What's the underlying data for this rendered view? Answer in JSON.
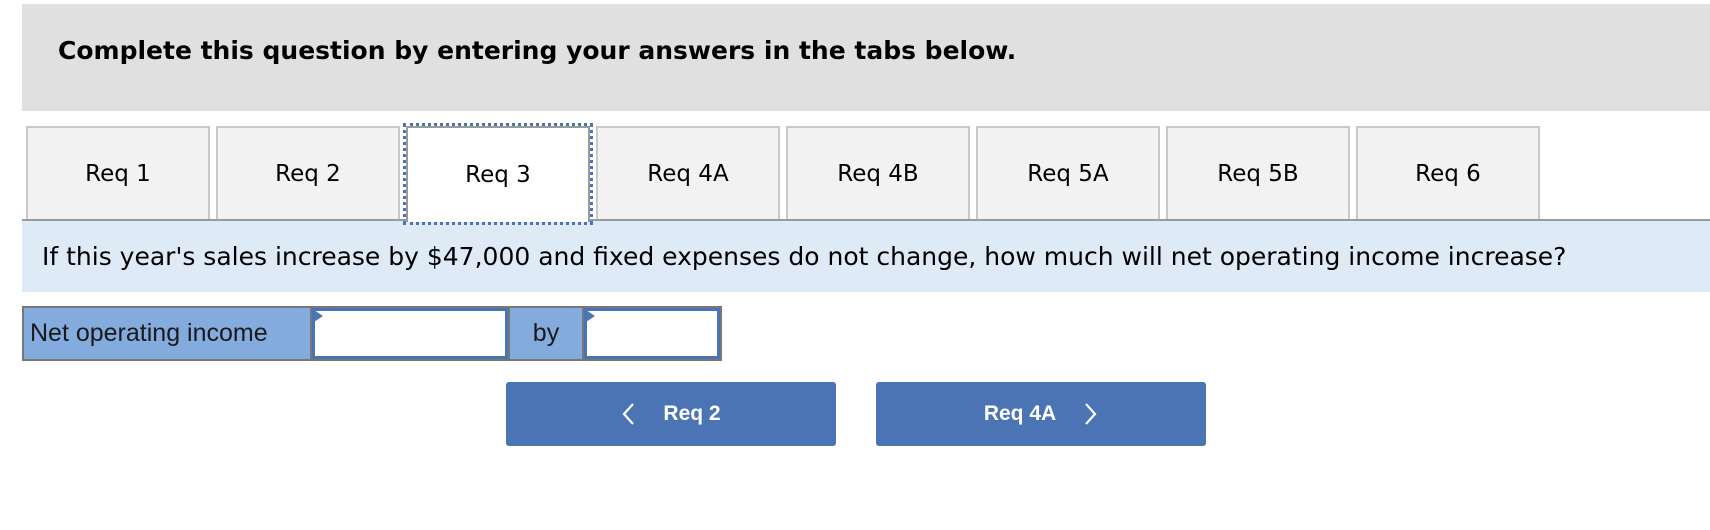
{
  "header": {
    "title": "Complete this question by entering your answers in the tabs below."
  },
  "tabs": [
    {
      "label": "Req 1",
      "active": false
    },
    {
      "label": "Req 2",
      "active": false
    },
    {
      "label": "Req 3",
      "active": true
    },
    {
      "label": "Req 4A",
      "active": false
    },
    {
      "label": "Req 4B",
      "active": false
    },
    {
      "label": "Req 5A",
      "active": false
    },
    {
      "label": "Req 5B",
      "active": false
    },
    {
      "label": "Req 6",
      "active": false
    }
  ],
  "question": {
    "text": "If this year's sales increase by $47,000 and fixed expenses do not change, how much will net operating income increase?"
  },
  "answer": {
    "label": "Net operating income",
    "connector": "by",
    "first_value": "",
    "second_value": ""
  },
  "navigation": {
    "prev_label": "Req 2",
    "prev_icon": "chevron-left-icon",
    "next_label": "Req 4A",
    "next_icon": "chevron-right-icon"
  },
  "colors": {
    "header_bg": "#e0e0e0",
    "question_bg": "#dfeaf7",
    "label_bg": "#84abde",
    "accent": "#4a74b4",
    "tab_bg": "#f2f2f2"
  }
}
